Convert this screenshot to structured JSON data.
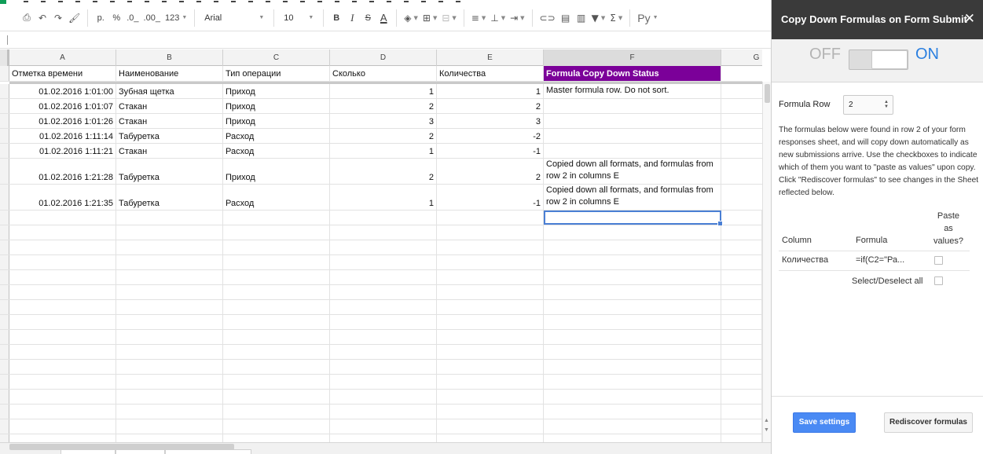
{
  "toolbar": {
    "currency": "р.",
    "percent": "%",
    "decimal_decrease": ".0_",
    "decimal_increase": ".00_",
    "number_format": "123",
    "font": "Arial",
    "font_size": "10",
    "bold": "B",
    "italic": "I",
    "strikethrough": "S",
    "text_color": "A",
    "input_tools": "Ру"
  },
  "grid": {
    "columns": [
      "A",
      "B",
      "C",
      "D",
      "E",
      "F",
      "G"
    ],
    "headers": [
      "Отметка времени",
      "Наименование",
      "Тип операции",
      "Сколько",
      "Количества",
      "Formula Copy Down Status"
    ],
    "rows": [
      [
        "01.02.2016 1:01:00",
        "Зубная щетка",
        "Приход",
        "1",
        "1",
        "Master formula row. Do not sort."
      ],
      [
        "01.02.2016 1:01:07",
        "Стакан",
        "Приход",
        "2",
        "2",
        ""
      ],
      [
        "01.02.2016 1:01:26",
        "Стакан",
        "Приход",
        "3",
        "3",
        ""
      ],
      [
        "01.02.2016 1:11:14",
        "Табуретка",
        "Расход",
        "2",
        "-2",
        ""
      ],
      [
        "01.02.2016 1:11:21",
        "Стакан",
        "Расход",
        "1",
        "-1",
        ""
      ],
      [
        "01.02.2016 1:21:28",
        "Табуретка",
        "Приход",
        "2",
        "2",
        "Copied down all formats, and formulas from row 2 in columns E"
      ],
      [
        "01.02.2016 1:21:35",
        "Табуретка",
        "Расход",
        "1",
        "-1",
        "Copied down all formats, and formulas from row 2 in columns E"
      ]
    ]
  },
  "colors": {
    "status_header_bg": "#7b0099",
    "toggle_on": "#2a7fe0",
    "save_button": "#4a8af4",
    "sidebar_title_bg": "#3a3a3a"
  },
  "sidebar": {
    "title": "Copy Down Formulas on Form Submit",
    "close_icon": "✕",
    "toggle_off_label": "OFF",
    "toggle_on_label": "ON",
    "toggle_state": "on",
    "formula_row_label": "Formula Row",
    "formula_row_value": "2",
    "description": "The formulas below were found in row 2 of your form responses sheet, and will copy down automatically as new submissions arrive. Use the checkboxes to indicate which of them you want to \"paste as values\" upon copy. Click \"Rediscover formulas\" to see changes in the Sheet reflected below.",
    "table": {
      "col_column": "Column",
      "col_formula": "Formula",
      "col_paste_1": "Paste",
      "col_paste_2": "as",
      "col_paste_3": "values?",
      "row_column": "Количества",
      "row_formula": "=if(C2=\"Ра...",
      "select_all": "Select/Deselect all"
    },
    "save_button": "Save settings",
    "rediscover_button": "Rediscover formulas"
  }
}
